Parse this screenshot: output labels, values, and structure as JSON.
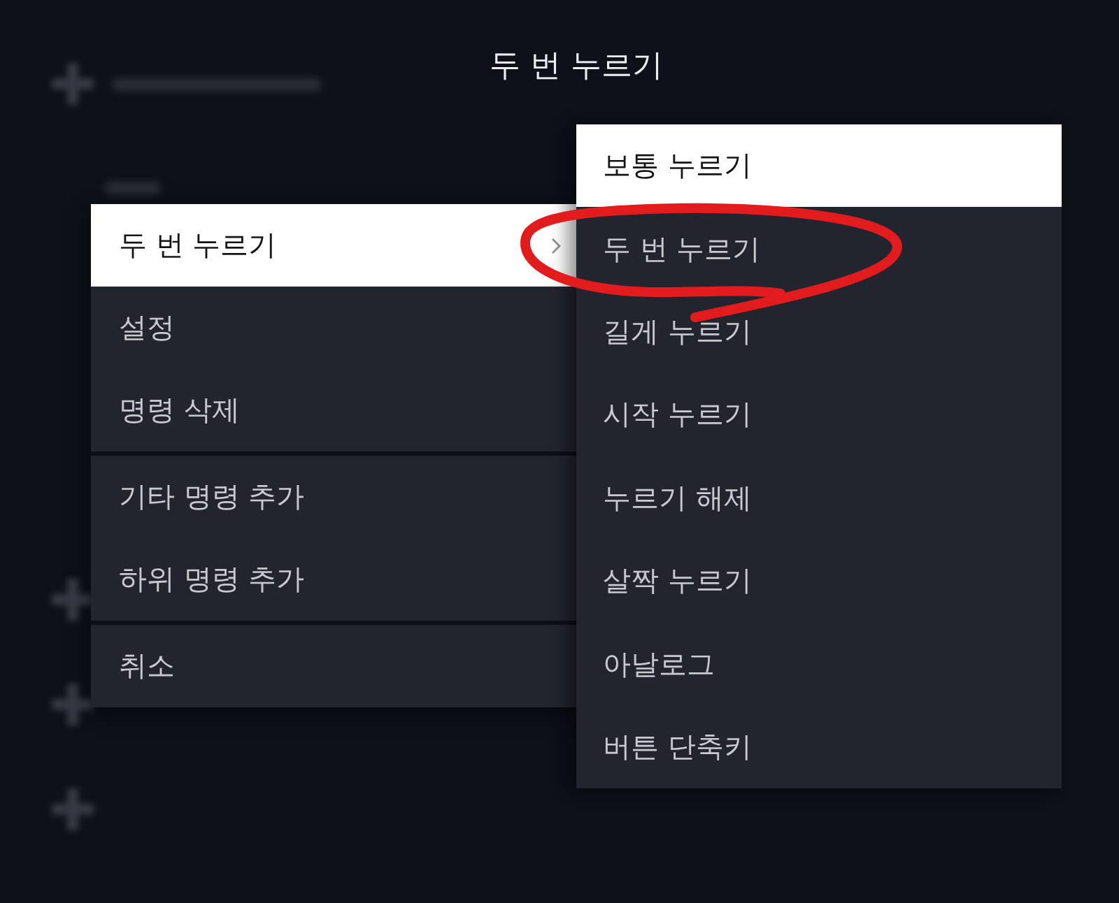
{
  "title": "두 번 누르기",
  "context_menu": {
    "groups": [
      {
        "items": [
          {
            "label": "두 번 누르기",
            "selected": true,
            "submenu": true
          },
          {
            "label": "설정",
            "selected": false,
            "submenu": false
          },
          {
            "label": "명령 삭제",
            "selected": false,
            "submenu": false
          }
        ]
      },
      {
        "items": [
          {
            "label": "기타 명령 추가",
            "selected": false,
            "submenu": false
          },
          {
            "label": "하위 명령 추가",
            "selected": false,
            "submenu": false
          }
        ]
      },
      {
        "items": [
          {
            "label": "취소",
            "selected": false,
            "submenu": false
          }
        ]
      }
    ]
  },
  "submenu": {
    "items": [
      {
        "label": "보통 누르기",
        "selected": true,
        "circled": false
      },
      {
        "label": "두 번 누르기",
        "selected": false,
        "circled": true
      },
      {
        "label": "길게 누르기",
        "selected": false,
        "circled": false
      },
      {
        "label": "시작 누르기",
        "selected": false,
        "circled": false
      },
      {
        "label": "누르기 해제",
        "selected": false,
        "circled": false
      },
      {
        "label": "살짝 누르기",
        "selected": false,
        "circled": false
      },
      {
        "label": "아날로그",
        "selected": false,
        "circled": false
      },
      {
        "label": "버튼 단축키",
        "selected": false,
        "circled": false
      }
    ]
  }
}
